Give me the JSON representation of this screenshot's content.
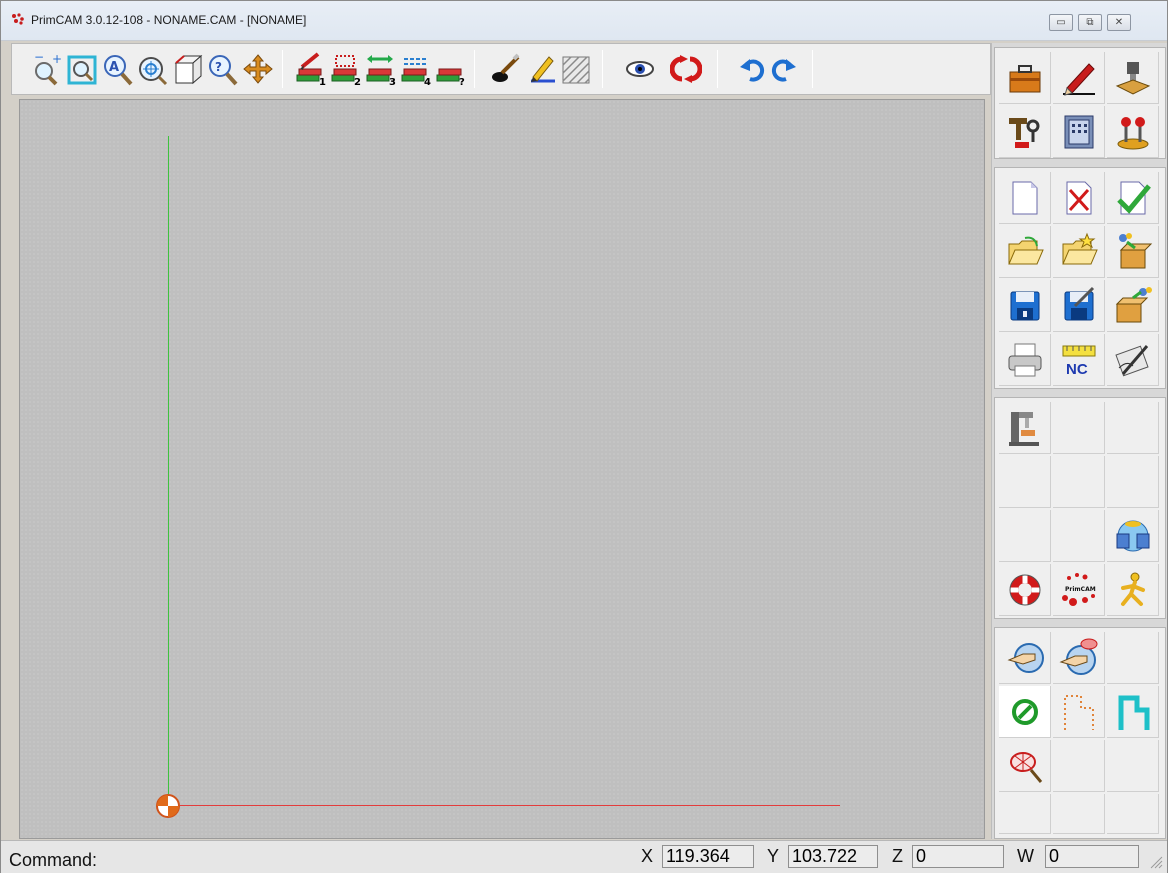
{
  "window": {
    "title": "PrimCAM 3.0.12-108  -  NONAME.CAM - [NONAME]",
    "controls": {
      "minimize": "▭",
      "restore": "⧉",
      "close": "✕"
    }
  },
  "toolbar": {
    "buttons": [
      {
        "icon": "zoom-in-icon"
      },
      {
        "icon": "zoom-window-icon"
      },
      {
        "icon": "zoom-all-icon"
      },
      {
        "icon": "zoom-center-icon"
      },
      {
        "icon": "view-3d-icon"
      },
      {
        "icon": "zoom-prev-icon"
      },
      {
        "icon": "pan-icon"
      },
      {
        "icon": "draw-layer-1-icon",
        "sub": "1"
      },
      {
        "icon": "draw-layer-2-icon",
        "sub": "2"
      },
      {
        "icon": "draw-layer-3-icon",
        "sub": "3"
      },
      {
        "icon": "draw-layer-4-icon",
        "sub": "4"
      },
      {
        "icon": "layer-query-icon",
        "sub": "?"
      },
      {
        "icon": "brush-icon"
      },
      {
        "icon": "highlighter-icon"
      },
      {
        "icon": "hatch-icon"
      },
      {
        "icon": "eye-icon"
      },
      {
        "icon": "regenerate-icon"
      },
      {
        "icon": "undo-icon"
      },
      {
        "icon": "redo-icon"
      }
    ]
  },
  "panel": {
    "groups": [
      {
        "name": "modes",
        "icons": [
          "toolbox-icon",
          "draw-pencil-icon",
          "machine-stamp-icon",
          "tools-icon",
          "calculator-book-icon",
          "joystick-icon"
        ]
      },
      {
        "name": "file",
        "icons": [
          "new-file-icon",
          "close-file-icon",
          "check-file-icon",
          "open-folder-icon",
          "star-folder-icon",
          "import-box-icon",
          "save-icon",
          "save-as-icon",
          "export-box-icon",
          "print-icon",
          "nc-icon",
          "sign-icon"
        ]
      },
      {
        "name": "machine",
        "icons": [
          "machine-icon",
          "",
          "",
          "",
          "",
          "",
          "",
          "",
          "network-icon",
          "lifebuoy-icon",
          "primcam-logo-icon",
          "run-man-icon"
        ]
      },
      {
        "name": "select",
        "icons": [
          "pointer-hand-icon",
          "pointer-hand-alert-icon",
          "",
          "snap-circle-icon",
          "contour-dots-icon",
          "contour-solid-icon",
          "select-net-icon",
          "",
          "",
          "",
          "",
          ""
        ]
      }
    ],
    "nc_label": "NC",
    "logo_text": "PrimCAM"
  },
  "status": {
    "command_label": "Command:",
    "x_label": "X",
    "x_value": "119.364",
    "y_label": "Y",
    "y_value": "103.722",
    "z_label": "Z",
    "z_value": "0",
    "w_label": "W",
    "w_value": "0"
  },
  "colors": {
    "x_axis": "#e33c3c",
    "y_axis": "#3ec23e",
    "canvas_bg": "#bfbfbf"
  }
}
